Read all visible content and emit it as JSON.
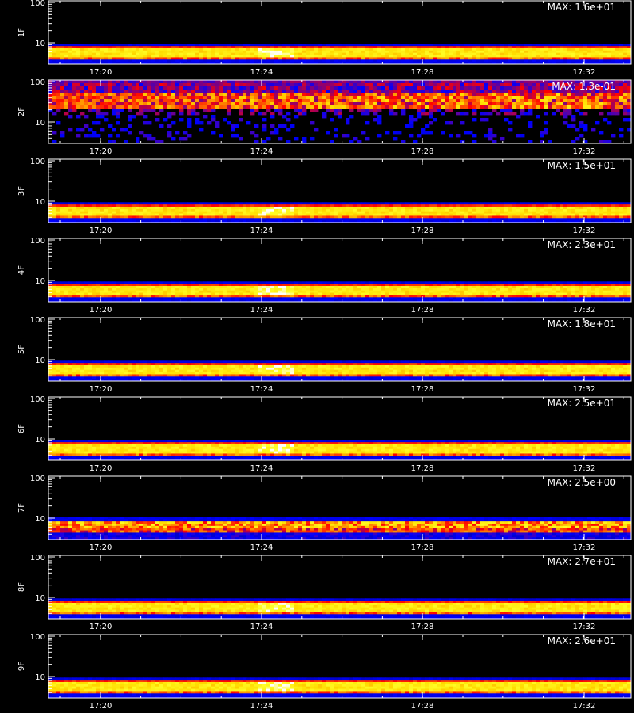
{
  "chart_data": {
    "type": "heatmap",
    "description": "Stacked spectrogram panels; color intensity encodes power vs time (x) and frequency (y, log scale).",
    "x_tick_labels": [
      "17:20",
      "17:24",
      "17:28",
      "17:32"
    ],
    "y_tick_labels": [
      "100",
      "10"
    ],
    "y_scale": "log",
    "panels": [
      {
        "name": "1F",
        "max_label": "MAX: 1.6e+01"
      },
      {
        "name": "2F",
        "max_label": "MAX: 1.3e-01"
      },
      {
        "name": "3F",
        "max_label": "MAX: 1.5e+01"
      },
      {
        "name": "4F",
        "max_label": "MAX: 2.3e+01"
      },
      {
        "name": "5F",
        "max_label": "MAX: 1.8e+01"
      },
      {
        "name": "6F",
        "max_label": "MAX: 2.5e+01"
      },
      {
        "name": "7F",
        "max_label": "MAX: 2.5e+00"
      },
      {
        "name": "8F",
        "max_label": "MAX: 2.7e+01"
      },
      {
        "name": "9F",
        "max_label": "MAX: 2.6e+01"
      }
    ],
    "colors": {
      "background": "#000000",
      "frame": "#ffffff",
      "low": "#0000ff",
      "mid": "#ff0000",
      "high": "#ffff00",
      "peak": "#ffffff"
    }
  }
}
